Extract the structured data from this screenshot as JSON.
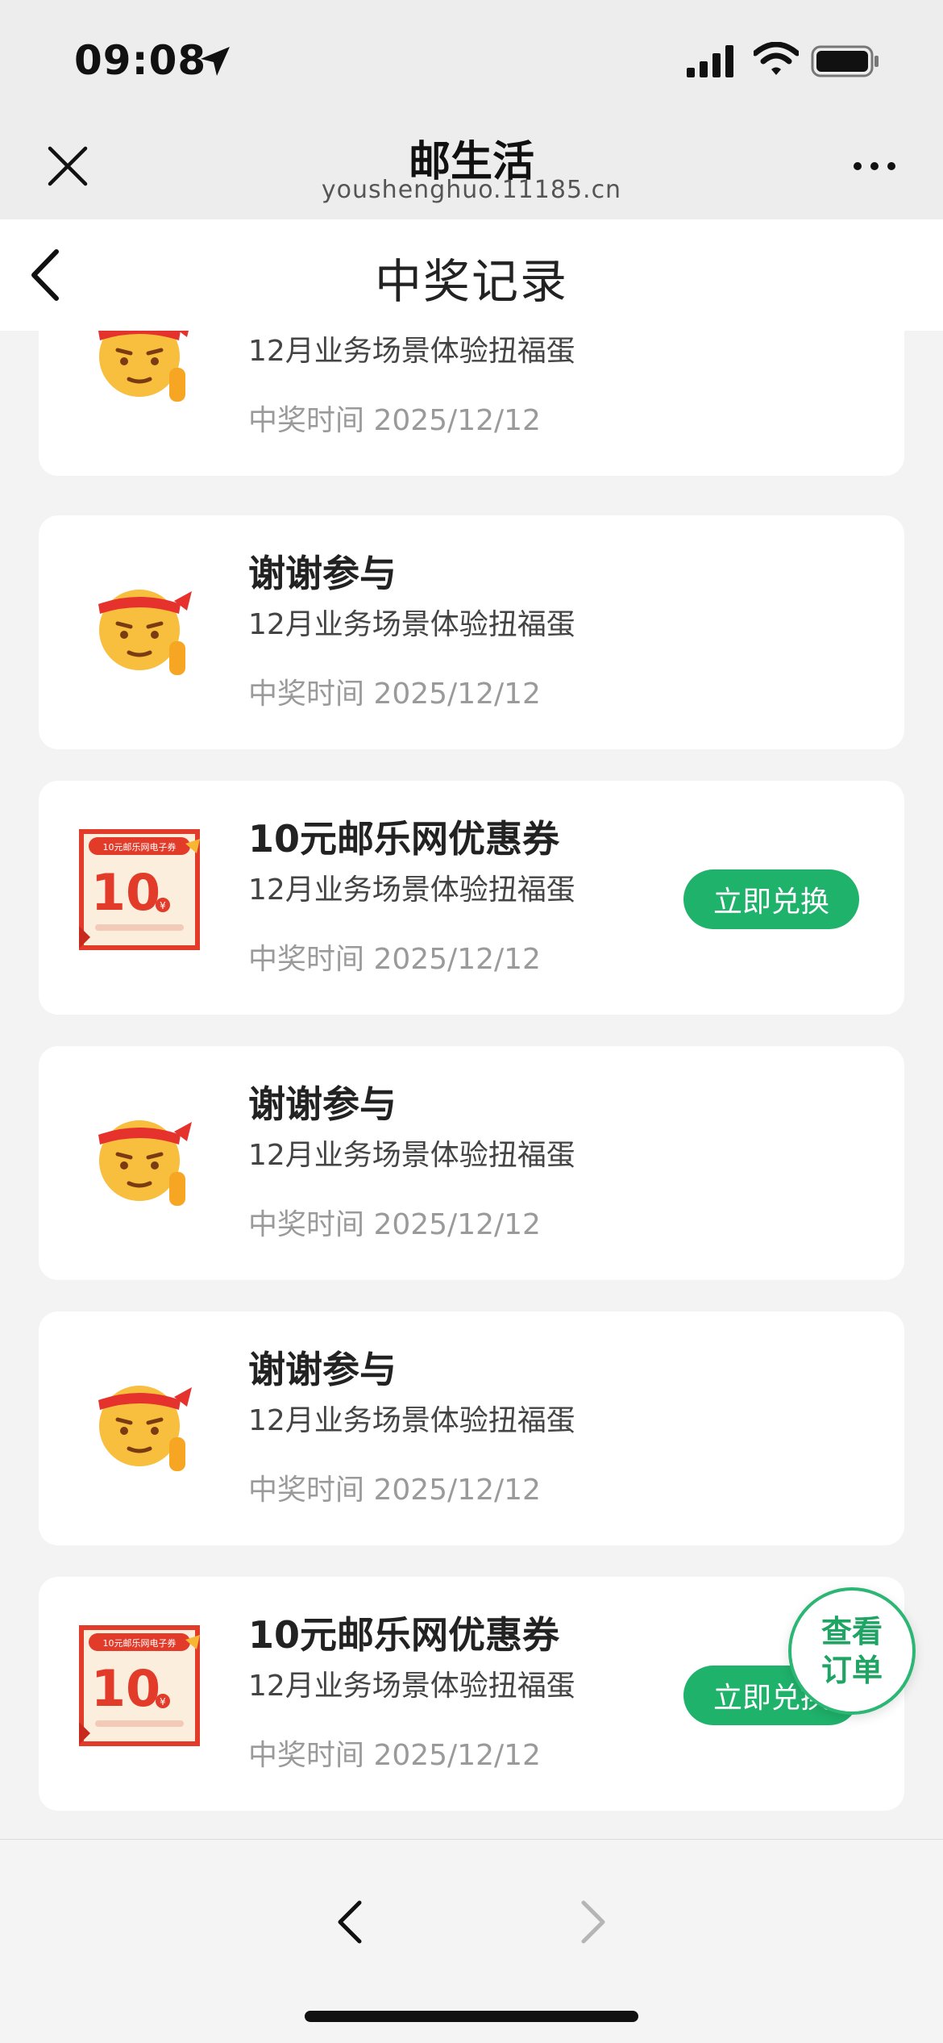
{
  "status_bar": {
    "time": "09:08"
  },
  "browser": {
    "title": "邮生活",
    "url": "youshenghuo.11185.cn"
  },
  "page": {
    "title": "中奖记录"
  },
  "coupon_art": {
    "banner": "10元邮乐网电子券",
    "amount": "10",
    "currency": "¥"
  },
  "records": [
    {
      "type": "thanks",
      "name": "",
      "campaign": "12月业务场景体验扭福蛋",
      "time": "中奖时间 2025/12/12"
    },
    {
      "type": "thanks",
      "name": "谢谢参与",
      "campaign": "12月业务场景体验扭福蛋",
      "time": "中奖时间 2025/12/12"
    },
    {
      "type": "coupon",
      "name": "10元邮乐网优惠券",
      "campaign": "12月业务场景体验扭福蛋",
      "time": "中奖时间 2025/12/12",
      "button": "立即兑换"
    },
    {
      "type": "thanks",
      "name": "谢谢参与",
      "campaign": "12月业务场景体验扭福蛋",
      "time": "中奖时间 2025/12/12"
    },
    {
      "type": "thanks",
      "name": "谢谢参与",
      "campaign": "12月业务场景体验扭福蛋",
      "time": "中奖时间 2025/12/12"
    },
    {
      "type": "coupon",
      "name": "10元邮乐网优惠券",
      "campaign": "12月业务场景体验扭福蛋",
      "time": "中奖时间 2025/12/12",
      "button": "立即兑换"
    }
  ],
  "float_button": {
    "line1": "查看",
    "line2": "订单"
  },
  "colors": {
    "accent_green": "#1fb26b",
    "page_bg": "#f3f3f3",
    "coupon_red": "#e23b2a"
  }
}
